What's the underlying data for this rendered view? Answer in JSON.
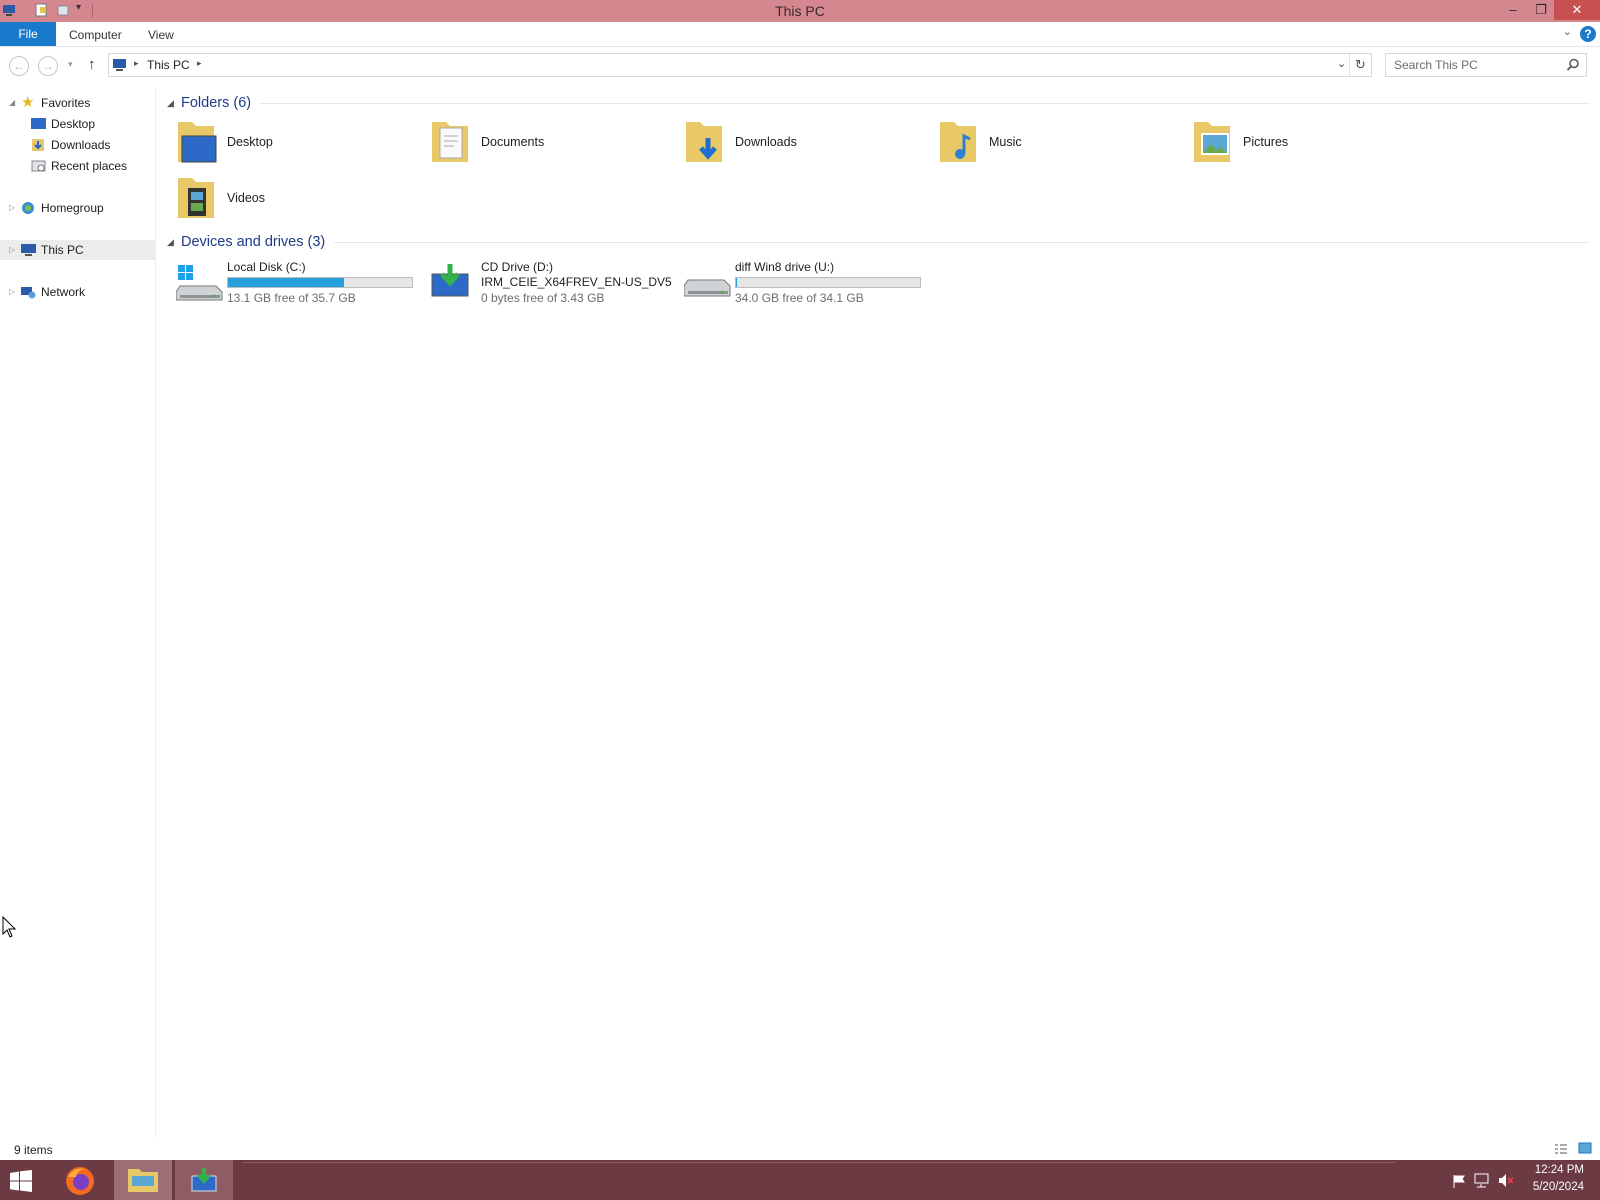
{
  "window": {
    "title": "This PC"
  },
  "ribbon": {
    "tabs": [
      "File",
      "Computer",
      "View"
    ]
  },
  "address": {
    "path": [
      "This PC"
    ],
    "search_placeholder": "Search This PC"
  },
  "sidebar": {
    "favorites": {
      "label": "Favorites",
      "items": [
        "Desktop",
        "Downloads",
        "Recent places"
      ]
    },
    "homegroup": "Homegroup",
    "thispc": "This PC",
    "network": "Network"
  },
  "folders": {
    "header": "Folders (6)",
    "items": [
      "Desktop",
      "Documents",
      "Downloads",
      "Music",
      "Pictures",
      "Videos"
    ]
  },
  "drives": {
    "header": "Devices and drives (3)",
    "items": [
      {
        "name": "Local Disk (C:)",
        "free": "13.1 GB free of 35.7 GB",
        "used_fraction": 0.63
      },
      {
        "name": "CD Drive (D:)",
        "label": "IRM_CEIE_X64FREV_EN-US_DV5",
        "free": "0 bytes free of 3.43 GB"
      },
      {
        "name": "diff Win8 drive (U:)",
        "free": "34.0 GB free of 34.1 GB",
        "used_fraction": 0.003
      }
    ]
  },
  "status": {
    "count": "9 items"
  },
  "taskbar": {
    "time": "12:24 PM",
    "date": "5/20/2024"
  },
  "colors": {
    "titlebar": "#d5878f",
    "taskbar": "#6b3a42",
    "accent": "#1979ca",
    "drive_fill": "#26a0da"
  }
}
